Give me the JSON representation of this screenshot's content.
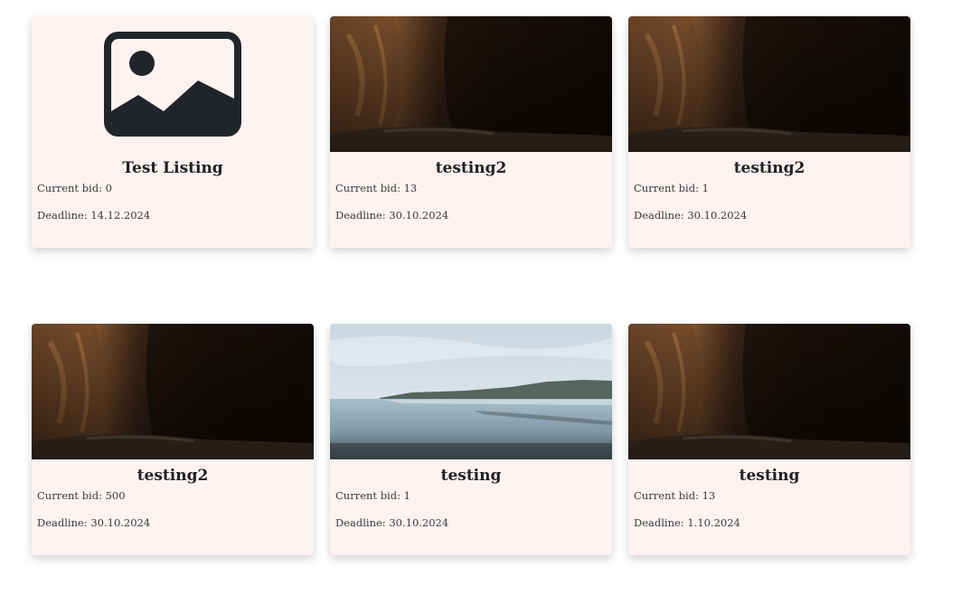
{
  "listings": [
    {
      "title": "Test Listing",
      "image": "placeholder-image-icon",
      "current_bid_label": "Current bid: 0",
      "deadline_label": "Deadline: 14.12.2024"
    },
    {
      "title": "testing2",
      "image": "canyon-photo",
      "current_bid_label": "Current bid: 13",
      "deadline_label": "Deadline: 30.10.2024"
    },
    {
      "title": "testing2",
      "image": "canyon-photo",
      "current_bid_label": "Current bid: 1",
      "deadline_label": "Deadline: 30.10.2024"
    },
    {
      "title": "testing2",
      "image": "canyon-photo",
      "current_bid_label": "Current bid: 500",
      "deadline_label": "Deadline: 30.10.2024"
    },
    {
      "title": "testing",
      "image": "lake-photo",
      "current_bid_label": "Current bid: 1",
      "deadline_label": "Deadline: 30.10.2024"
    },
    {
      "title": "testing",
      "image": "canyon-photo",
      "current_bid_label": "Current bid: 13",
      "deadline_label": "Deadline: 1.10.2024"
    }
  ],
  "colors": {
    "card_background": "#fdf1f1",
    "title_text": "#222222",
    "body_text": "#3b3b3b",
    "placeholder_icon": "#212529"
  }
}
